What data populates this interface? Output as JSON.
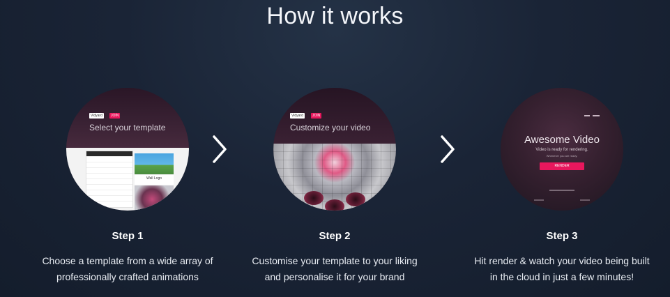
{
  "page": {
    "title": "How it works"
  },
  "steps": [
    {
      "label": "Step 1",
      "desc_line1": "Choose a template from a wide array of",
      "desc_line2": "professionally crafted animations",
      "preview": {
        "heading": "Select your template",
        "logo_text": "Vidyard",
        "badge_text": "JOIN",
        "thumb_title": "Wall Logo"
      }
    },
    {
      "label": "Step 2",
      "desc_line1": "Customise your template to your liking",
      "desc_line2": "and personalise it for your brand",
      "preview": {
        "heading": "Customize your video",
        "logo_text": "Vidyard",
        "badge_text": "JOIN"
      }
    },
    {
      "label": "Step 3",
      "desc_line1": "Hit render & watch your video being built",
      "desc_line2": "in the cloud in just a few minutes!",
      "preview": {
        "heading": "Awesome Video",
        "subtext": "Video is ready for rendering.",
        "subtext2": "Whenever you are ready.",
        "button_text": "RENDER"
      }
    }
  ],
  "icons": {
    "next": "chevron-right-icon"
  },
  "colors": {
    "accent": "#e8175d",
    "background": "#1a2436",
    "text": "#ffffff"
  }
}
